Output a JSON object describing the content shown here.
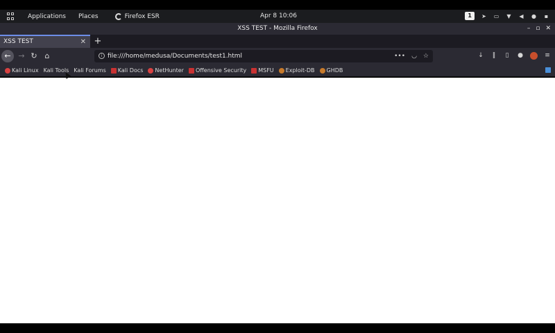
{
  "panel": {
    "applications_label": "Applications",
    "places_label": "Places",
    "active_app_label": "Firefox ESR",
    "clock": "Apr 8  10:06",
    "workspace": "1"
  },
  "window": {
    "title": "XSS TEST - Mozilla Firefox"
  },
  "tabs": [
    {
      "label": "XSS TEST",
      "active": true
    }
  ],
  "urlbar": {
    "url": "file:///home/medusa/Documents/test1.html"
  },
  "bookmarks": [
    {
      "label": "Kali Linux",
      "icon": "kali-dragon-icon"
    },
    {
      "label": "Kali Tools",
      "icon": "kali-tools-icon"
    },
    {
      "label": "Kali Forums",
      "icon": "kali-tools-icon"
    },
    {
      "label": "Kali Docs",
      "icon": "kali-docs-icon"
    },
    {
      "label": "NetHunter",
      "icon": "kali-dragon-icon"
    },
    {
      "label": "Offensive Security",
      "icon": "offsec-icon"
    },
    {
      "label": "MSFU",
      "icon": "offsec-icon"
    },
    {
      "label": "Exploit-DB",
      "icon": "exploitdb-icon"
    },
    {
      "label": "GHDB",
      "icon": "exploitdb-icon"
    }
  ],
  "colors": {
    "panel_bg": "#1b1c1f",
    "toolbar_bg": "#2b2a33",
    "active_tab_bg": "#42414d",
    "tab_accent": "#6d8ee8",
    "page_bg": "#ffffff"
  }
}
